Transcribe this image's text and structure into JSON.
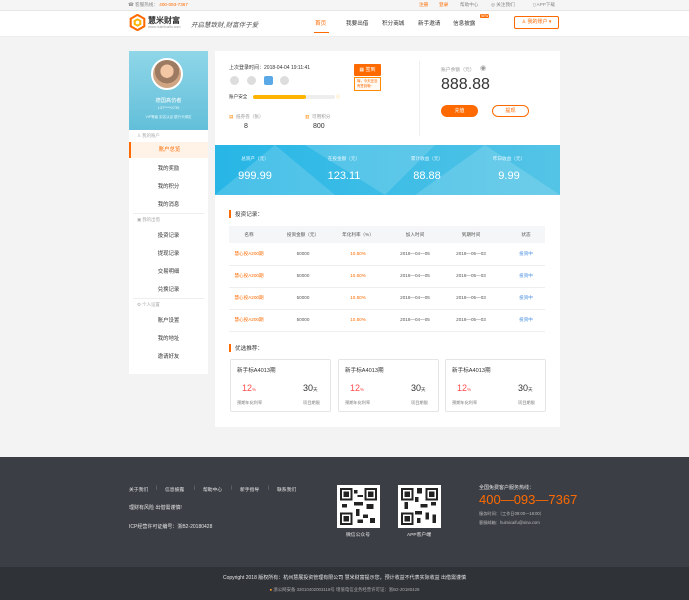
{
  "topbar": {
    "hotline_label": "客服热线：",
    "hotline": "400-093-7367",
    "links": [
      "注册",
      "登录",
      "帮助中心",
      "关注我们",
      "APP下载"
    ]
  },
  "header": {
    "brand": "慧米财富",
    "brand_sub": "www.huimicaifu.com",
    "slogan": "开启慧致财,财富伴于爱",
    "nav": [
      "首页",
      "我要出借",
      "积分商城",
      "新手邀请",
      "信息披露"
    ],
    "new_tag": "NEW",
    "my_account": "我的账户"
  },
  "sidebar": {
    "username": "德国高仿者",
    "phone": "137****0739",
    "badges": "VIP等级  实名认证  银行卡绑定",
    "groups": [
      {
        "label": "我的账户",
        "items": [
          "账户总览",
          "我的奖励",
          "我的积分",
          "我的消息"
        ]
      },
      {
        "label": "我的出借",
        "items": [
          "投资记录",
          "提现记录",
          "交易明细",
          "兑换记录"
        ]
      },
      {
        "label": "个人设置",
        "items": [
          "账户设置",
          "我的地址",
          "邀请好友"
        ]
      }
    ]
  },
  "account": {
    "last_login_label": "上次登录时间：",
    "last_login": "2018-04-04  19:11:41",
    "security_label": "账户安全",
    "security_level": 0.65,
    "security_info": "ⓘ",
    "coupon_label": "抵券卷（张）",
    "coupon_value": "8",
    "points_label": "可用积分",
    "points_value": "800",
    "sign_button": "签到",
    "sign_tip": "嗨，今天还没有签到哦~",
    "balance_label": "账户余额（元）",
    "balance": "888.88",
    "recharge": "充值",
    "withdraw": "提现"
  },
  "stats": [
    {
      "label": "总资产（元）",
      "value": "999.99"
    },
    {
      "label": "在投金额（元）",
      "value": "123.11"
    },
    {
      "label": "累计收益（元）",
      "value": "88.88"
    },
    {
      "label": "昨日收益（元）",
      "value": "9.99"
    }
  ],
  "records": {
    "title": "投资记录：",
    "columns": [
      "名称",
      "投资金额（元）",
      "年化利率（%）",
      "加入时间",
      "到期时间",
      "状态"
    ],
    "rows": [
      [
        "慧心投A200期",
        "50000",
        "10.50%",
        "2018—04—05",
        "2018—05—03",
        "投资中"
      ],
      [
        "慧心投A200期",
        "50000",
        "10.50%",
        "2018—04—05",
        "2018—05—03",
        "投资中"
      ],
      [
        "慧心投A200期",
        "50000",
        "10.50%",
        "2018—04—05",
        "2018—05—03",
        "投资中"
      ],
      [
        "慧心投A200期",
        "50000",
        "10.50%",
        "2018—04—05",
        "2018—05—03",
        "投资中"
      ]
    ]
  },
  "recommend": {
    "title": "优选推荐：",
    "products": [
      {
        "name": "新手标A4013期",
        "rate": "12",
        "rate_unit": "%",
        "rate_label": "预期年化利率",
        "days": "30",
        "days_unit": "天",
        "days_label": "项目期限"
      },
      {
        "name": "新手标A4013期",
        "rate": "12",
        "rate_unit": "%",
        "rate_label": "预期年化利率",
        "days": "30",
        "days_unit": "天",
        "days_label": "项目期限"
      },
      {
        "name": "新手标A4013期",
        "rate": "12",
        "rate_unit": "%",
        "rate_label": "预期年化利率",
        "days": "30",
        "days_unit": "天",
        "days_label": "项目期限"
      }
    ]
  },
  "footer": {
    "links": [
      "关于我们",
      "信息披露",
      "帮助中心",
      "新手指导",
      "联系我们"
    ],
    "risk": "理财有风险 出借需谨慎!",
    "icp": "ICP经营许可证编号：浙B2-20180428",
    "qr_labels": [
      "微信公众号",
      "APP客户端"
    ],
    "hotline_label": "全国免费客户服务热线：",
    "hotline": "400—093—7367",
    "service_time": "服务时间：（工作日09:00—18:00）",
    "email": "客服邮箱：huimicaifu@sina.com",
    "copyright": "Copyright  2018 版权所有：杭州慧展投资管理有限公司  慧米财富提示您，预计收益不代表实际收益  出借需谨慎",
    "beian": "浙公网安备 33010402003118号    增值电信业务经营许可证：浙B2-20180428"
  },
  "colors": {
    "accent": "#ff6a00",
    "banner": "#27b6e6",
    "footer": "#3b3e45"
  }
}
